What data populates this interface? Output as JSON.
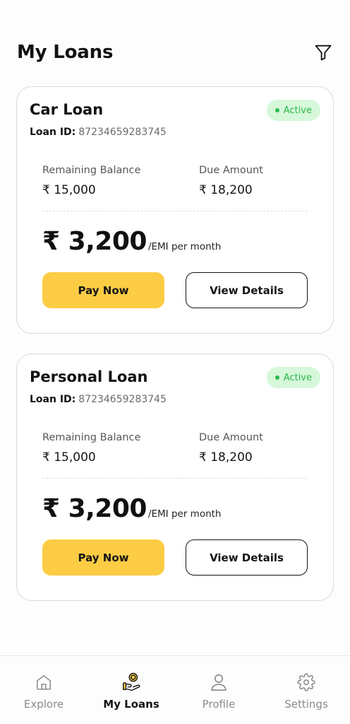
{
  "header": {
    "title": "My Loans",
    "filter_icon": "filter-icon"
  },
  "loans": [
    {
      "name": "Car Loan",
      "status": "Active",
      "loan_id_label": "Loan ID:",
      "loan_id": "87234659283745",
      "remaining_label": "Remaining Balance",
      "remaining_value": "₹ 15,000",
      "due_label": "Due Amount",
      "due_value": "₹ 18,200",
      "emi_amount": "₹ 3,200",
      "emi_suffix": "/EMI per month",
      "pay_label": "Pay Now",
      "view_label": "View Details"
    },
    {
      "name": "Personal Loan",
      "status": "Active",
      "loan_id_label": "Loan ID:",
      "loan_id": "87234659283745",
      "remaining_label": "Remaining Balance",
      "remaining_value": "₹ 15,000",
      "due_label": "Due Amount",
      "due_value": "₹ 18,200",
      "emi_amount": "₹ 3,200",
      "emi_suffix": "/EMI per month",
      "pay_label": "Pay Now",
      "view_label": "View Details"
    }
  ],
  "nav": {
    "items": [
      {
        "label": "Explore",
        "icon": "home-icon",
        "active": false
      },
      {
        "label": "My Loans",
        "icon": "hand-coin-icon",
        "active": true
      },
      {
        "label": "Profile",
        "icon": "user-icon",
        "active": false
      },
      {
        "label": "Settings",
        "icon": "gear-icon",
        "active": false
      }
    ]
  },
  "colors": {
    "accent": "#fdcc45",
    "active_badge_bg": "#d6f7da",
    "active_badge_text": "#2cb84a",
    "text": "#141414"
  }
}
